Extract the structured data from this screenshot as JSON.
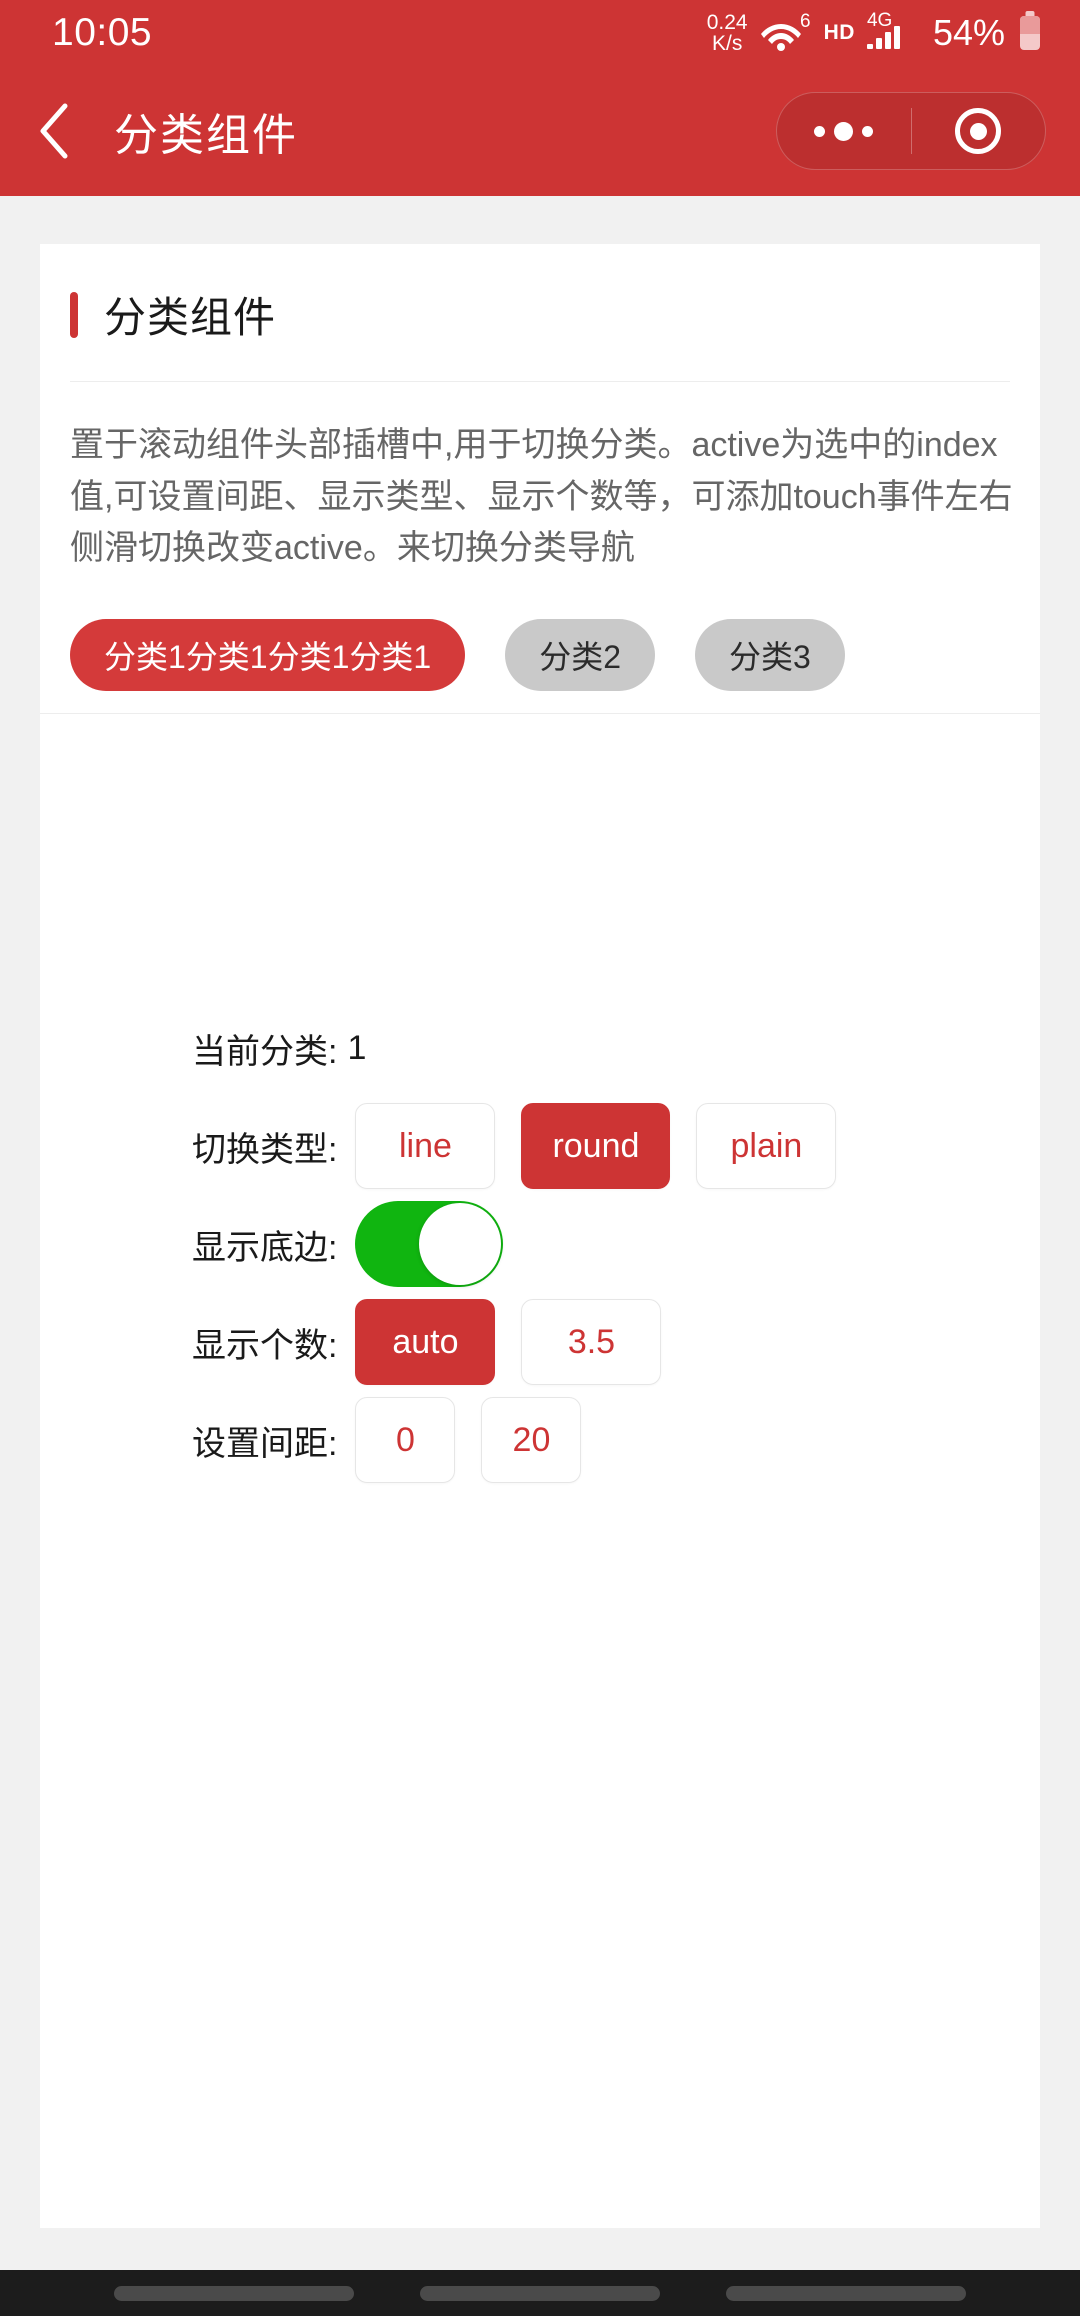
{
  "status_bar": {
    "time": "10:05",
    "net_speed_value": "0.24",
    "net_speed_unit": "K/s",
    "wifi_generation": "6",
    "hd_label": "HD",
    "mobile_generation": "4G",
    "battery_percent": "54%"
  },
  "nav_bar": {
    "title": "分类组件",
    "back_icon": "chevron-left-icon",
    "capsule_more_icon": "more-dots-icon",
    "capsule_target_icon": "target-circle-icon"
  },
  "card": {
    "title": "分类组件",
    "description": "置于滚动组件头部插槽中,用于切换分类。active为选中的index值,可设置间距、显示类型、显示个数等，可添加touch事件左右侧滑切换改变active。来切换分类导航",
    "tabs": [
      {
        "label": "分类1分类1分类1分类1",
        "active": true
      },
      {
        "label": "分类2",
        "active": false
      },
      {
        "label": "分类3",
        "active": false
      }
    ]
  },
  "settings": {
    "current_category": {
      "label": "当前分类:",
      "value": "1"
    },
    "switch_type": {
      "label": "切换类型:",
      "options": [
        "line",
        "round",
        "plain"
      ],
      "selected": "round"
    },
    "show_bottom_line": {
      "label": "显示底边:",
      "enabled": true
    },
    "show_count": {
      "label": "显示个数:",
      "options": [
        "auto",
        "3.5"
      ],
      "selected": "auto"
    },
    "gap": {
      "label": "设置间距:",
      "options": [
        "0",
        "20"
      ],
      "selected": "20"
    }
  },
  "colors": {
    "brand_red": "#cd3434",
    "tab_inactive": "#c9c9c9",
    "toggle_on": "#10b510",
    "page_bg": "#f1f1f1"
  }
}
